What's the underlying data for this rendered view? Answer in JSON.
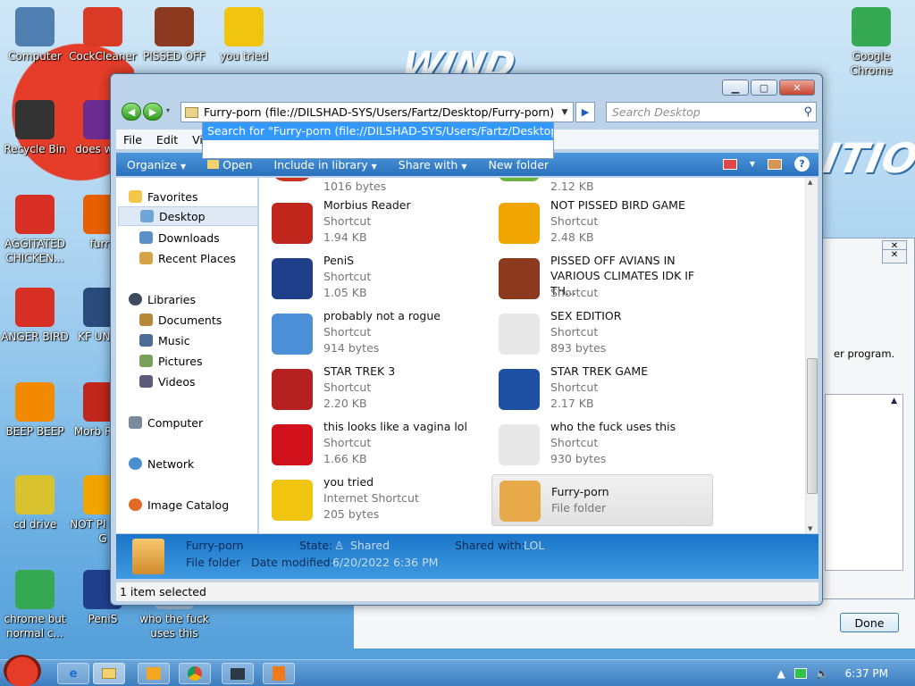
{
  "wallpaper": {
    "word1": "WIND",
    "word2": "ITION"
  },
  "desktop_icons": [
    {
      "label": "Computer",
      "icon": "computer-icon",
      "color": "#4f7fb0"
    },
    {
      "label": "CockCleaner",
      "icon": "ccleaner-icon",
      "color": "#d83a26"
    },
    {
      "label": "PISSED OFF",
      "icon": "angry-birds-seasons-icon",
      "color": "#8b3a1f"
    },
    {
      "label": "you tried",
      "icon": "star-icon",
      "color": "#f1c40f"
    },
    {
      "label": "Recycle Bin",
      "icon": "recycle-bin-icon",
      "color": "#333333"
    },
    {
      "label": "does work",
      "icon": "yahoo-icon",
      "color": "#6b2c91"
    },
    {
      "label": "AGGITATED CHICKEN...",
      "icon": "angry-bird-icon",
      "color": "#d93025"
    },
    {
      "label": "furry",
      "icon": "firefox-icon",
      "color": "#e66000"
    },
    {
      "label": "ANGER BIRD",
      "icon": "angry-bird-icon",
      "color": "#d93025"
    },
    {
      "label": "KF UNIVE",
      "icon": "angry-birds-space-icon",
      "color": "#2a4b7c"
    },
    {
      "label": "BEEP BEEP",
      "icon": "vlc-icon",
      "color": "#f28a00"
    },
    {
      "label": "Morb Read",
      "icon": "pdf-reader-icon",
      "color": "#c0261b"
    },
    {
      "label": "cd drive",
      "icon": "cd-drive-icon",
      "color": "#d9c230"
    },
    {
      "label": "NOT PI BIRD G",
      "icon": "bad-piggies-icon",
      "color": "#f0a500"
    },
    {
      "label": "chrome but normal c...",
      "icon": "chrome-icon",
      "color": "#34a853"
    },
    {
      "label": "PeniS",
      "icon": "photoshop-icon",
      "color": "#1f3f8a"
    },
    {
      "label": "who the fuck uses this",
      "icon": "blank-icon",
      "color": "#9fb8d4"
    },
    {
      "label": "Google Chrome",
      "icon": "chrome-icon",
      "color": "#34a853"
    }
  ],
  "explorer": {
    "address": "Furry-porn (file://DILSHAD-SYS/Users/Fartz/Desktop/Furry-porn)",
    "search_placeholder": "Search Desktop",
    "autocomplete": "Search for \"Furry-porn (file://DILSHAD-SYS/Users/Fartz/Desktop/Furry-porn)\"",
    "menu": [
      "File",
      "Edit",
      "Vi"
    ],
    "commands": [
      "Organize",
      "Open",
      "Include in library",
      "Share with",
      "New folder"
    ],
    "nav": {
      "favorites": "Favorites",
      "desktop": "Desktop",
      "downloads": "Downloads",
      "recent": "Recent Places",
      "libraries": "Libraries",
      "documents": "Documents",
      "music": "Music",
      "pictures": "Pictures",
      "videos": "Videos",
      "computer": "Computer",
      "network": "Network",
      "image_catalog": "Image Catalog"
    },
    "top_partial": [
      "1016 bytes",
      "2.12 KB"
    ],
    "files": [
      {
        "name": "Morbius Reader",
        "type": "Shortcut",
        "size": "1.94 KB",
        "icon": "pdf-reader-icon",
        "color": "#c0261b"
      },
      {
        "name": "NOT PISSED BIRD GAME",
        "type": "Shortcut",
        "size": "2.48 KB",
        "icon": "bad-piggies-icon",
        "color": "#f0a500"
      },
      {
        "name": "PeniS",
        "type": "Shortcut",
        "size": "1.05 KB",
        "icon": "photoshop-icon",
        "color": "#1f3f8a"
      },
      {
        "name": "PISSED OFF AVIANS IN VARIOUS CLIMATES IDK IF TH...",
        "type": "Shortcut",
        "size": "",
        "icon": "angry-birds-seasons-icon",
        "color": "#8b3a1f"
      },
      {
        "name": "probably not a rogue",
        "type": "Shortcut",
        "size": "914 bytes",
        "icon": "gears-icon",
        "color": "#4b8fd6"
      },
      {
        "name": "SEX EDITIOR",
        "type": "Shortcut",
        "size": "893 bytes",
        "icon": "hxd-icon",
        "color": "#e8e8e8"
      },
      {
        "name": "STAR TREK 3",
        "type": "Shortcut",
        "size": "2.20 KB",
        "icon": "angry-birds-star-wars-icon",
        "color": "#b52020"
      },
      {
        "name": "STAR TREK GAME",
        "type": "Shortcut",
        "size": "2.17 KB",
        "icon": "angry-birds-star-wars-icon",
        "color": "#1e4fa0"
      },
      {
        "name": "this looks like a vagina lol",
        "type": "Shortcut",
        "size": "1.66 KB",
        "icon": "opera-icon",
        "color": "#d0111b"
      },
      {
        "name": "who the fuck uses this",
        "type": "Shortcut",
        "size": "930 bytes",
        "icon": "winamp-icon",
        "color": "#e8e8e8"
      },
      {
        "name": "you tried",
        "type": "Internet Shortcut",
        "size": "205 bytes",
        "icon": "star-icon",
        "color": "#f1c40f"
      },
      {
        "name": "Furry-porn",
        "type": "File folder",
        "size": "",
        "icon": "folder-icon",
        "color": "#e8a94a"
      }
    ],
    "details": {
      "name": "Furry-porn",
      "type": "File folder",
      "state_label": "State:",
      "state_value": "Shared",
      "modified_label": "Date modified:",
      "modified_value": "6/20/2022 6:36 PM",
      "shared_label": "Shared with:",
      "shared_value": "LOL"
    },
    "status": "1 item selected"
  },
  "background_dialog": {
    "text": "er program.",
    "done": "Done"
  },
  "taskbar": {
    "time": "6:37 PM"
  }
}
